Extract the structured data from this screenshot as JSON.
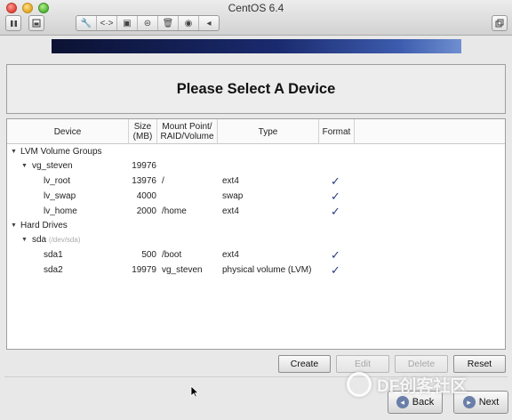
{
  "window": {
    "title": "CentOS 6.4"
  },
  "toolbar": {
    "icons": [
      "pause-icon",
      "screenshot-icon",
      "wrench-icon",
      "code-arrows-icon",
      "disk-icon",
      "lock-icon",
      "trash-icon",
      "cd-icon",
      "left-arrow-icon",
      "restore-window-icon"
    ]
  },
  "installer": {
    "heading": "Please Select A Device",
    "columns": {
      "device": "Device",
      "size": "Size\n(MB)",
      "mount": "Mount Point/\nRAID/Volume",
      "type": "Type",
      "format": "Format"
    },
    "rows": [
      {
        "device": "LVM Volume Groups",
        "size": "",
        "mount": "",
        "type": "",
        "format": ""
      },
      {
        "device": "vg_steven",
        "size": "19976",
        "mount": "",
        "type": "",
        "format": ""
      },
      {
        "device": "lv_root",
        "size": "13976",
        "mount": "/",
        "type": "ext4",
        "format": "✓"
      },
      {
        "device": "lv_swap",
        "size": "4000",
        "mount": "",
        "type": "swap",
        "format": "✓"
      },
      {
        "device": "lv_home",
        "size": "2000",
        "mount": "/home",
        "type": "ext4",
        "format": "✓"
      },
      {
        "device": "Hard Drives",
        "size": "",
        "mount": "",
        "type": "",
        "format": ""
      },
      {
        "device": "sda",
        "device_sub": "(/dev/sda)",
        "size": "",
        "mount": "",
        "type": "",
        "format": ""
      },
      {
        "device": "sda1",
        "size": "500",
        "mount": "/boot",
        "type": "ext4",
        "format": "✓"
      },
      {
        "device": "sda2",
        "size": "19979",
        "mount": "vg_steven",
        "type": "physical volume (LVM)",
        "format": "✓"
      }
    ],
    "buttons": {
      "create": "Create",
      "edit": "Edit",
      "delete": "Delete",
      "reset": "Reset"
    },
    "nav": {
      "back": "Back",
      "next": "Next"
    }
  },
  "watermark": {
    "text": "DF创客社区"
  }
}
